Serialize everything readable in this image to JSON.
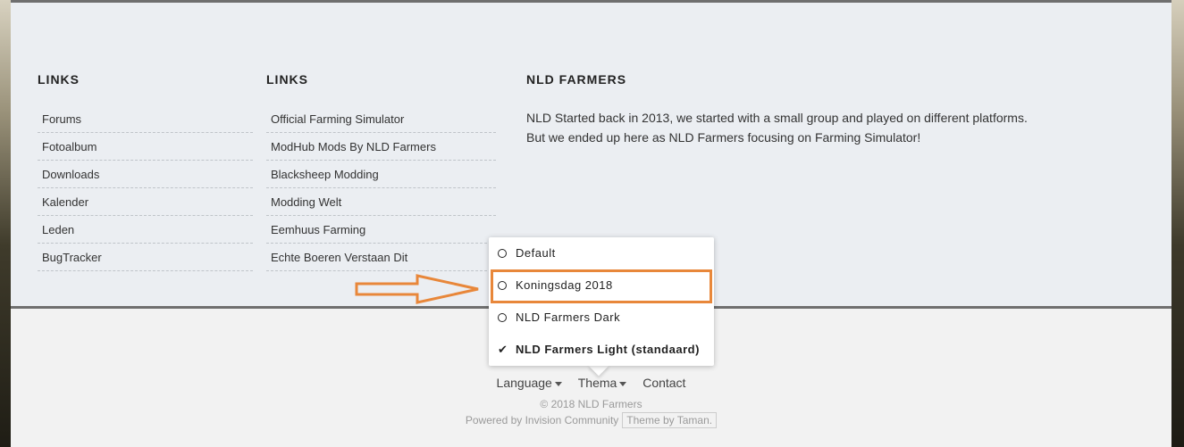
{
  "columns": [
    {
      "title": "LINKS",
      "items": [
        "Forums",
        "Fotoalbum",
        "Downloads",
        "Kalender",
        "Leden",
        "BugTracker"
      ]
    },
    {
      "title": "LINKS",
      "items": [
        "Official Farming Simulator",
        "ModHub Mods By NLD Farmers",
        "Blacksheep Modding",
        "Modding Welt",
        "Eemhuus Farming",
        "Echte Boeren Verstaan Dit"
      ]
    },
    {
      "title": "NLD FARMERS",
      "about_line1": "NLD Started back in 2013, we started with a small group and played on different platforms.",
      "about_line2": "But we ended up here as NLD Farmers focusing on Farming Simulator!"
    }
  ],
  "theme_menu": {
    "items": [
      {
        "label": "Default",
        "selected": false
      },
      {
        "label": "Koningsdag 2018",
        "selected": false,
        "highlighted": true
      },
      {
        "label": "NLD Farmers Dark",
        "selected": false
      },
      {
        "label": "NLD Farmers Light (standaard)",
        "selected": true
      }
    ]
  },
  "bottom_nav": {
    "language": "Language",
    "theme": "Thema",
    "contact": "Contact"
  },
  "copyright": "© 2018 NLD Farmers",
  "powered_by": "Powered by Invision Community",
  "theme_by": "Theme by Taman.",
  "colors": {
    "highlight": "#e8873a",
    "footer_bg": "#ebeef2"
  }
}
